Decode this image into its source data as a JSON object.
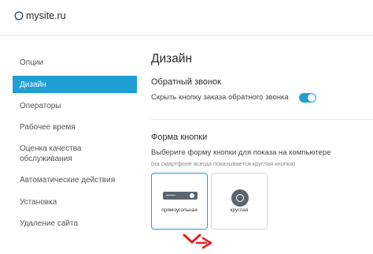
{
  "header": {
    "site_name": "mysite.ru",
    "logo_icon": "chat-bubble-icon"
  },
  "sidebar": {
    "items": [
      {
        "label": "Опции",
        "active": false
      },
      {
        "label": "Дизайн",
        "active": true
      },
      {
        "label": "Операторы",
        "active": false
      },
      {
        "label": "Рабочее время",
        "active": false
      },
      {
        "label": "Оценка качества",
        "active": false
      },
      {
        "label": "обслуживания",
        "active": false
      },
      {
        "label": "Автоматические действия",
        "active": false
      },
      {
        "label": "Установка",
        "active": false
      },
      {
        "label": "Удаление сайта",
        "active": false
      }
    ]
  },
  "main": {
    "title": "Дизайн",
    "callback_section": {
      "title": "Обратный звонок",
      "toggle_label": "Скрыть кнопку заказа обратного звонка",
      "toggle_on": true
    },
    "button_shape_section": {
      "title": "Форма кнопки",
      "description": "Выберите форму кнопки для показа на компьютере",
      "hint": "(на смартфоне всегда показывается круглая кнопка)",
      "options": [
        {
          "label": "прямоугольная",
          "selected": true,
          "icon": "rectangular-button-icon"
        },
        {
          "label": "круглая",
          "selected": false,
          "icon": "round-button-icon"
        }
      ]
    }
  },
  "colors": {
    "accent": "#1f9fd4",
    "pointer_arrows": "#e0201b",
    "button_preview": "#5c6470"
  }
}
